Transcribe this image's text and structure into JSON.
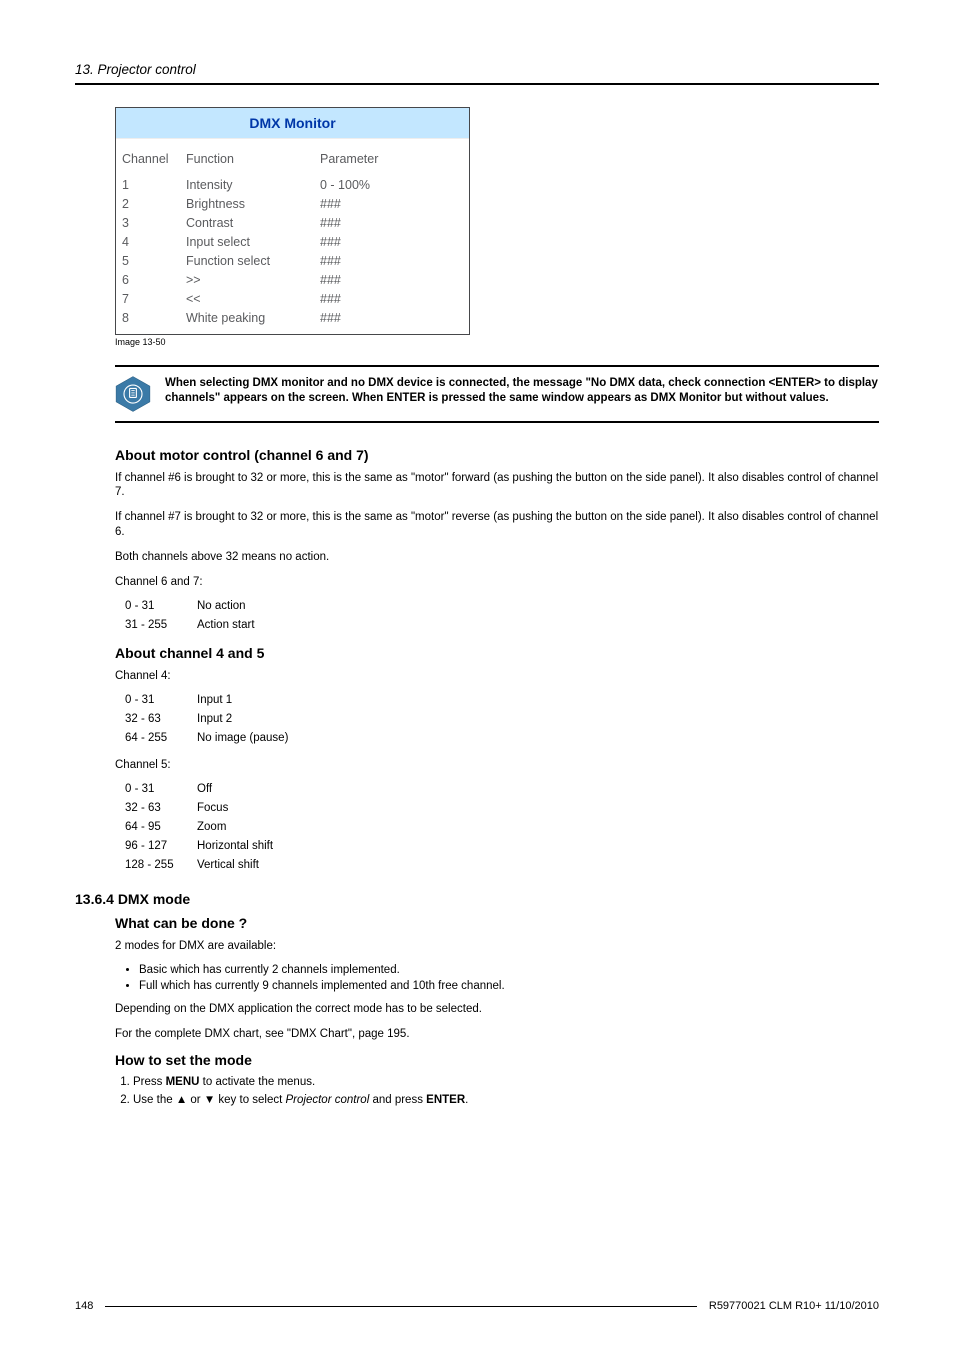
{
  "header": {
    "section": "13.  Projector control"
  },
  "dmx_monitor": {
    "title": "DMX Monitor",
    "headers": [
      "Channel",
      "Function",
      "Parameter"
    ],
    "rows": [
      {
        "ch": "1",
        "fn": "Intensity",
        "pa": "0 - 100%"
      },
      {
        "ch": "2",
        "fn": "Brightness",
        "pa": "###"
      },
      {
        "ch": "3",
        "fn": "Contrast",
        "pa": "###"
      },
      {
        "ch": "4",
        "fn": "Input select",
        "pa": "###"
      },
      {
        "ch": "5",
        "fn": "Function select",
        "pa": "###"
      },
      {
        "ch": "6",
        "fn": ">>",
        "pa": "###"
      },
      {
        "ch": "7",
        "fn": "<<",
        "pa": "###"
      },
      {
        "ch": "8",
        "fn": "White peaking",
        "pa": "###"
      }
    ],
    "caption": "Image 13-50"
  },
  "note": {
    "text": "When selecting DMX monitor and no DMX device is connected, the message \"No DMX data, check connection <ENTER> to display channels\" appears on the screen. When ENTER is pressed the same window appears as DMX Monitor but without values."
  },
  "motor": {
    "heading": "About motor control (channel 6 and 7)",
    "p1": "If channel #6 is brought to 32 or more, this is the same as \"motor\" forward (as pushing the button on the side panel). It also disables control of channel 7.",
    "p2": "If channel #7 is brought to 32 or more, this is the same as \"motor\" reverse (as pushing the button on the side panel). It also disables control of channel 6.",
    "p3": "Both channels above 32 means no action.",
    "p4": "Channel 6 and 7:",
    "rows": [
      {
        "k": "0 - 31",
        "v": "No action"
      },
      {
        "k": "31 - 255",
        "v": "Action start"
      }
    ]
  },
  "ch45": {
    "heading": "About channel 4 and 5",
    "ch4_label": "Channel 4:",
    "ch4": [
      {
        "k": "0 - 31",
        "v": "Input 1"
      },
      {
        "k": "32 - 63",
        "v": "Input 2"
      },
      {
        "k": "64 - 255",
        "v": "No image (pause)"
      }
    ],
    "ch5_label": "Channel 5:",
    "ch5": [
      {
        "k": "0 - 31",
        "v": "Off"
      },
      {
        "k": "32 - 63",
        "v": "Focus"
      },
      {
        "k": "64 - 95",
        "v": "Zoom"
      },
      {
        "k": "96 - 127",
        "v": "Horizontal shift"
      },
      {
        "k": "128 - 255",
        "v": "Vertical shift"
      }
    ]
  },
  "dmxmode": {
    "numheading": "13.6.4   DMX mode",
    "q": "What can be done ?",
    "intro": "2 modes for DMX are available:",
    "bullets": [
      "Basic which has currently 2 channels implemented.",
      "Full which has currently 9 channels implemented and 10th free channel."
    ],
    "p_depends": "Depending on the DMX application the correct mode has to be selected.",
    "p_chart": "For the complete DMX chart, see \"DMX Chart\", page 195.",
    "howto_heading": "How to set the mode",
    "step1_pre": "Press ",
    "step1_bold": "MENU",
    "step1_post": " to activate the menus.",
    "step2_pre": "Use the ▲ or ▼ key to select ",
    "step2_italic": "Projector control",
    "step2_mid": " and press ",
    "step2_bold": "ENTER",
    "step2_post": "."
  },
  "footer": {
    "page": "148",
    "doc": "R59770021 CLM R10+ 11/10/2010"
  }
}
